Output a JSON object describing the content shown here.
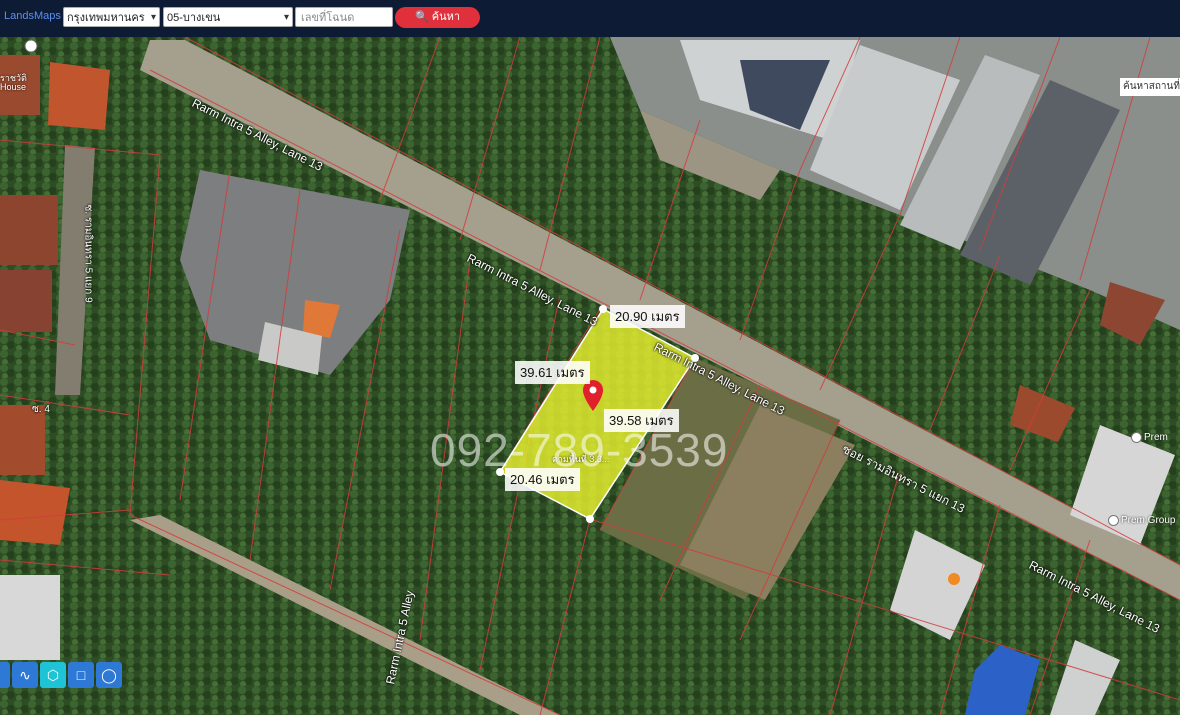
{
  "header": {
    "logo": "LandsMaps",
    "province": "กรุงเทพมหานคร",
    "district": "05-บางเขน",
    "deed_placeholder": "เลขที่โฉนด",
    "search_button": "ค้นหา"
  },
  "map": {
    "place_search": "ค้นหาสถานที่",
    "phone_watermark": "092-789-3539",
    "parcel_label": "ตามพื้นที่ 3.3..."
  },
  "dimensions": {
    "top": "20.90 เมตร",
    "left": "39.61 เมตร",
    "right": "39.58 เมตร",
    "bottom": "20.46 เมตร"
  },
  "roads": {
    "r1": "Rarm Intra 5 Alley, Lane 13",
    "r2": "Rarm Intra 5 Alley, Lane 13",
    "r3": "Rarm Intra 5 Alley, Lane 13",
    "r4": "ซอย รามอินทรา 5 แยก 13",
    "r5": "Rarm Intra 5 Alley, Lane 13",
    "r6": "Rarm Intra 5 Alley",
    "side1": "ซ. รามอินทรา 5 แยก 9",
    "side2": "ซ. 4"
  },
  "pois": {
    "left_top": "ราชวัติ\nHouse",
    "prem1": "Prem",
    "prem2": "Prem Group"
  },
  "tools": [
    "select",
    "draw-line",
    "draw-polygon",
    "draw-rectangle",
    "draw-circle"
  ],
  "colors": {
    "parcel_fill": "#e8f030",
    "parcel_border": "#ffffff",
    "pin": "#e0202a",
    "parcel_lines": "#d33c3c",
    "topbar": "#0e1b35",
    "search_button": "#e0303c"
  }
}
